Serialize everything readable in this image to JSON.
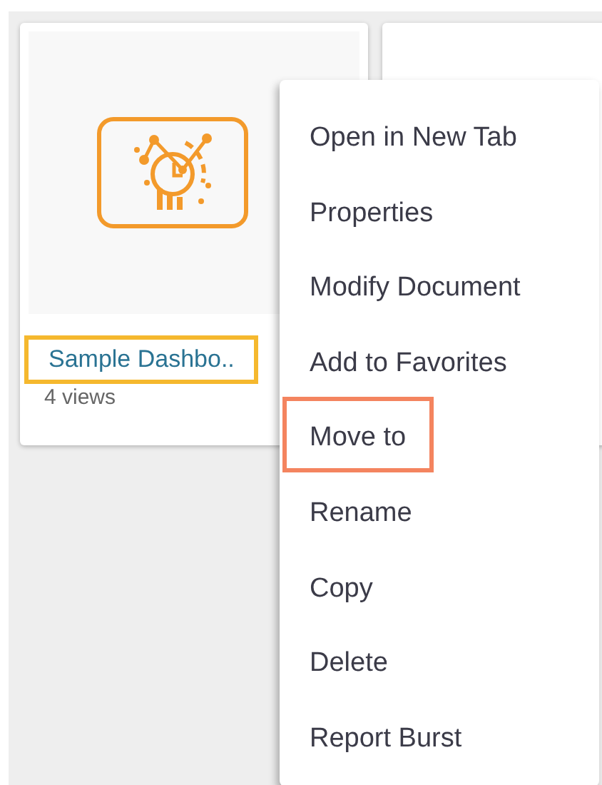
{
  "cards": [
    {
      "title": "Sample Dashbo..",
      "title_highlighted": true,
      "views": "4 views"
    }
  ],
  "context_menu": {
    "items": [
      {
        "label": "Open in New Tab",
        "highlighted": false
      },
      {
        "label": "Properties",
        "highlighted": false
      },
      {
        "label": "Modify Document",
        "highlighted": false
      },
      {
        "label": "Add to Favorites",
        "highlighted": false
      },
      {
        "label": "Move to",
        "highlighted": true
      },
      {
        "label": "Rename",
        "highlighted": false
      },
      {
        "label": "Copy",
        "highlighted": false
      },
      {
        "label": "Delete",
        "highlighted": false
      },
      {
        "label": "Report Burst",
        "highlighted": false
      }
    ]
  }
}
